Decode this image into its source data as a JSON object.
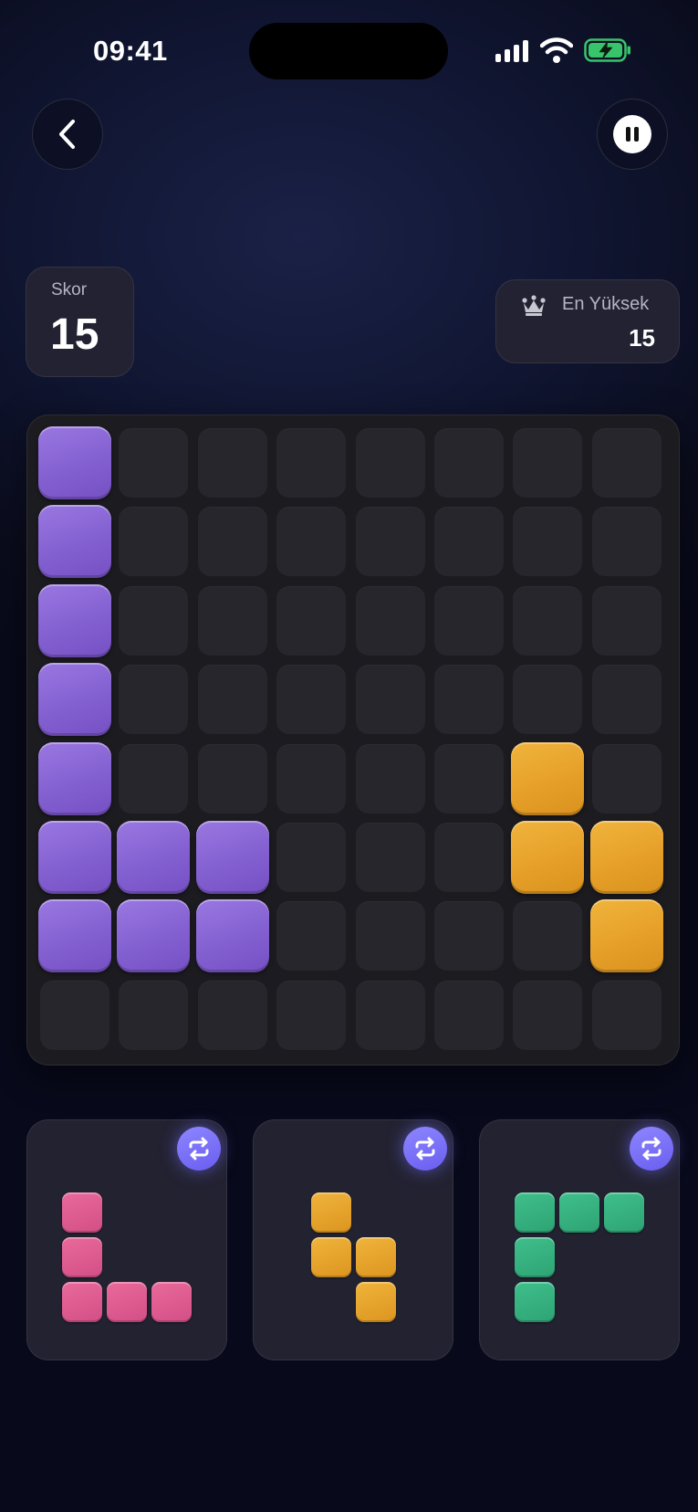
{
  "status_bar": {
    "time": "09:41"
  },
  "score": {
    "label": "Skor",
    "value": "15"
  },
  "best": {
    "label": "En Yüksek",
    "value": "15"
  },
  "board": {
    "rows": 8,
    "cols": 8,
    "cells": [
      "P.......",
      "P.......",
      "P.......",
      "P.......",
      "P.....O.",
      "PPP...OO",
      "PPP....O",
      "........"
    ]
  },
  "pieces": [
    {
      "color": "pink",
      "shape": [
        "X..",
        "X..",
        "XXX"
      ]
    },
    {
      "color": "orange",
      "shape": [
        "X.",
        "XX",
        ".X"
      ]
    },
    {
      "color": "green",
      "shape": [
        "XXX",
        "X..",
        "X.."
      ]
    }
  ],
  "colors": {
    "purple": "#8360d0",
    "orange": "#e6a02a",
    "pink": "#d24f85",
    "green": "#2ea374",
    "accent": "#6a5ef0"
  }
}
